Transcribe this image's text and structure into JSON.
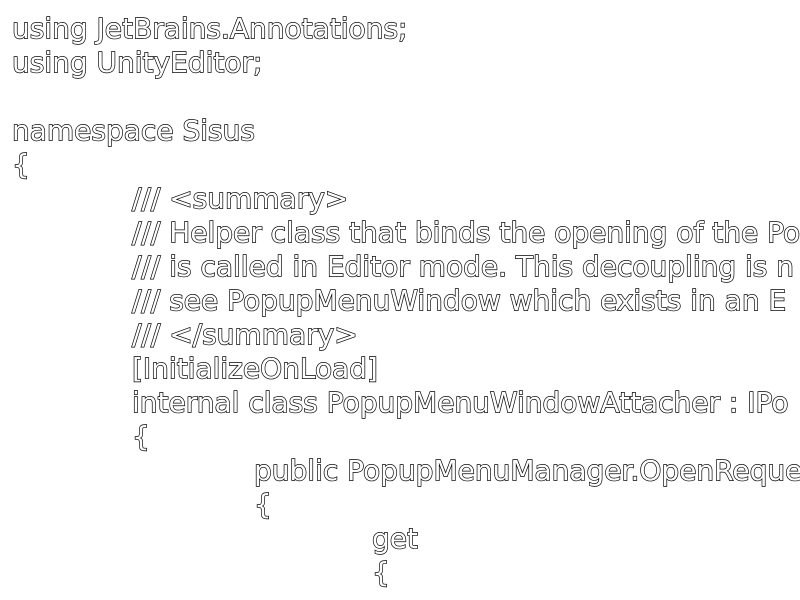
{
  "editor": {
    "lines": [
      "using JetBrains.Annotations;",
      "using UnityEditor;",
      "",
      "namespace Sisus",
      "{",
      "/// <summary>",
      "/// Helper class that binds the opening of the Po",
      "/// is called in Editor mode. This decoupling is n",
      "/// see PopupMenuWindow which exists in an E",
      "/// </summary>",
      "[InitializeOnLoad]",
      "internal class PopupMenuWindowAttacher : IPo",
      "{",
      "public PopupMenuManager.OpenReque",
      "{",
      "get",
      "{",
      "                                 "
    ]
  }
}
